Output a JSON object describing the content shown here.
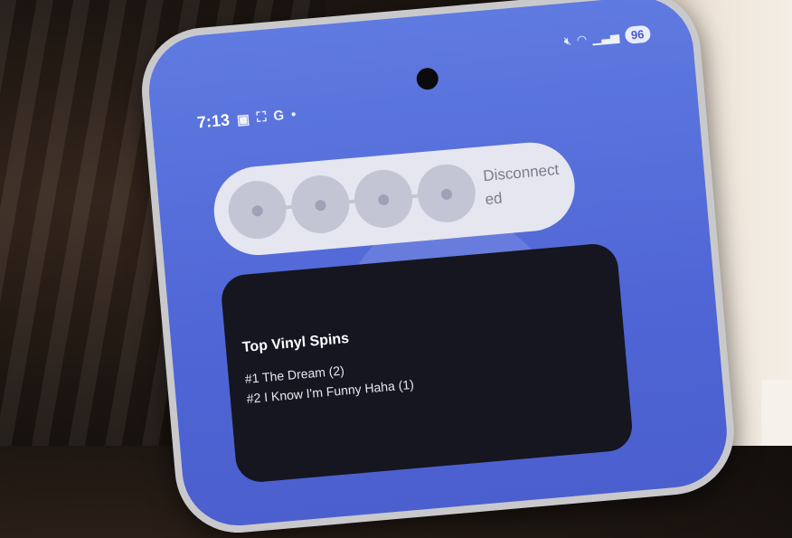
{
  "status_bar": {
    "time": "7:13",
    "battery": "96",
    "left_icons": [
      "gallery-icon",
      "screenshot-icon",
      "google-icon",
      "dot-icon"
    ],
    "right_icons": [
      "mute-icon",
      "wifi-icon",
      "signal-icon"
    ]
  },
  "connection_widget": {
    "status": "Disconnected",
    "avatars": [
      "person-icon",
      "person-icon",
      "person-icon",
      "person-icon"
    ]
  },
  "vinyl_widget": {
    "title": "Top Vinyl Spins",
    "items": [
      "#1 The Dream (2)",
      "#2 I Know I'm Funny Haha (1)"
    ]
  },
  "colors": {
    "screen": "#5066d6",
    "widget_light": "#e5e6ef",
    "widget_dark": "#15161f"
  }
}
